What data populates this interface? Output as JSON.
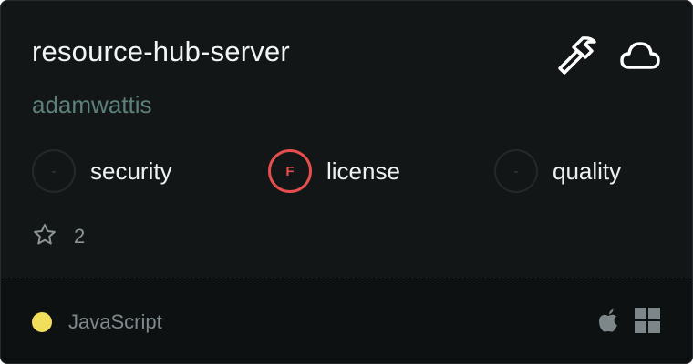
{
  "repo": {
    "name": "resource-hub-server",
    "owner": "adamwattis",
    "stars": "2"
  },
  "header_icons": [
    "hammer-icon",
    "cloud-icon"
  ],
  "scores": [
    {
      "label": "security",
      "grade": "-",
      "status": "neutral"
    },
    {
      "label": "license",
      "grade": "F",
      "status": "fail"
    },
    {
      "label": "quality",
      "grade": "-",
      "status": "neutral"
    }
  ],
  "footer": {
    "language": "JavaScript",
    "language_color": "#f1de5b",
    "platforms": [
      "apple-icon",
      "windows-icon"
    ]
  },
  "colors": {
    "background": "#121617",
    "fail": "#e84d4d",
    "owner": "#5e807a"
  }
}
